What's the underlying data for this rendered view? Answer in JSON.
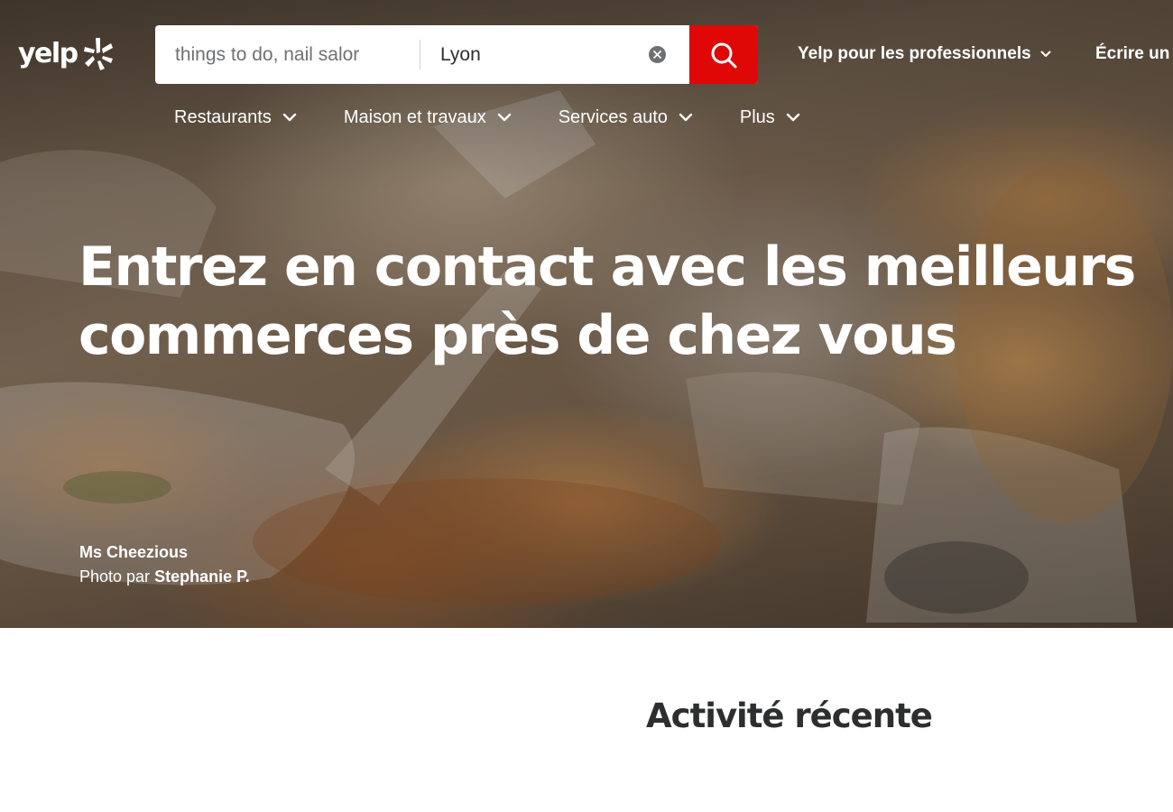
{
  "header": {
    "logo_text": "yelp",
    "search": {
      "find_placeholder": "things to do, nail salor",
      "near_value": "Lyon"
    },
    "top_links": [
      {
        "label": "Yelp pour les professionnels"
      },
      {
        "label": "Écrire un"
      }
    ],
    "categories": [
      {
        "label": "Restaurants"
      },
      {
        "label": "Maison et travaux"
      },
      {
        "label": "Services auto"
      },
      {
        "label": "Plus"
      }
    ]
  },
  "hero": {
    "headline_line1": "Entrez en contact avec les meilleurs",
    "headline_line2": "commerces près de chez vous",
    "business_name": "Ms Cheezious",
    "photo_by_prefix": "Photo par",
    "photographer": "Stephanie P."
  },
  "recent_activity": {
    "title": "Activité récente"
  },
  "colors": {
    "brand_red": "#e00707",
    "text_dark": "#2d2e2f",
    "white": "#ffffff"
  },
  "icons": [
    "yelp-burst-icon",
    "clear-icon",
    "search-icon",
    "chevron-down-icon"
  ]
}
